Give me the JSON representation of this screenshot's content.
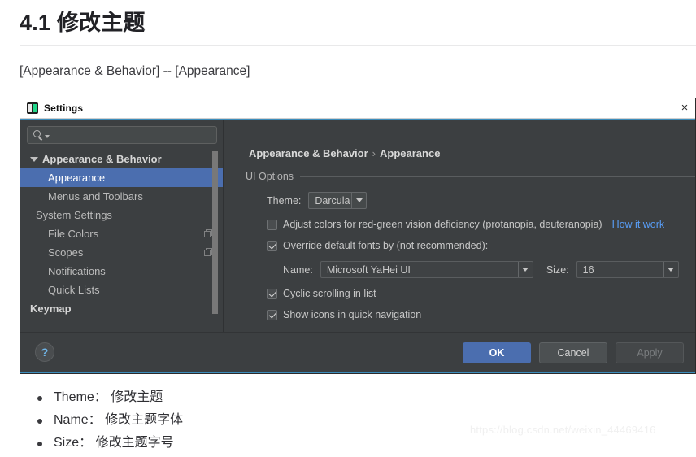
{
  "article": {
    "title": "4.1 修改主题",
    "subtitle": "[Appearance & Behavior] -- [Appearance]",
    "bullets": [
      "Theme： 修改主题",
      "Name： 修改主题字体",
      "Size： 修改主题字号"
    ],
    "watermark": "https://blog.csdn.net/weixin_44469416"
  },
  "window": {
    "title": "Settings",
    "app_icon": "pycharm-icon",
    "close_icon": "×",
    "accent_color": "#3c8dbc"
  },
  "sidebar": {
    "search": {
      "value": "",
      "placeholder": "",
      "icon": "search-icon",
      "caret_icon": "chevron-down-icon"
    },
    "items": [
      {
        "label": "Appearance & Behavior",
        "twisty": "down",
        "indent": 0,
        "bold": true,
        "selected": false,
        "badge": false
      },
      {
        "label": "Appearance",
        "twisty": "none",
        "indent": 1,
        "bold": false,
        "selected": true,
        "badge": false
      },
      {
        "label": "Menus and Toolbars",
        "twisty": "none",
        "indent": 1,
        "bold": false,
        "selected": false,
        "badge": false
      },
      {
        "label": "System Settings",
        "twisty": "right",
        "indent": 1,
        "bold": false,
        "selected": false,
        "badge": false
      },
      {
        "label": "File Colors",
        "twisty": "none",
        "indent": 1,
        "bold": false,
        "selected": false,
        "badge": true
      },
      {
        "label": "Scopes",
        "twisty": "none",
        "indent": 1,
        "bold": false,
        "selected": false,
        "badge": true
      },
      {
        "label": "Notifications",
        "twisty": "none",
        "indent": 1,
        "bold": false,
        "selected": false,
        "badge": false
      },
      {
        "label": "Quick Lists",
        "twisty": "none",
        "indent": 1,
        "bold": false,
        "selected": false,
        "badge": false
      },
      {
        "label": "Keymap",
        "twisty": "none",
        "indent": 0,
        "bold": true,
        "selected": false,
        "badge": false
      }
    ]
  },
  "main": {
    "breadcrumb": {
      "root": "Appearance & Behavior",
      "separator": "›",
      "leaf": "Appearance"
    },
    "group_title": "UI Options",
    "theme": {
      "label": "Theme:",
      "value": "Darcula"
    },
    "colorblind": {
      "label": "Adjust colors for red-green vision deficiency (protanopia, deuteranopia)",
      "checked": false,
      "link": "How it work"
    },
    "override_fonts": {
      "label": "Override default fonts by (not recommended):",
      "checked": true
    },
    "font_name": {
      "label": "Name:",
      "value": "Microsoft YaHei UI"
    },
    "font_size": {
      "label": "Size:",
      "value": "16"
    },
    "cyclic_scrolling": {
      "label": "Cyclic scrolling in list",
      "checked": true
    },
    "show_icons": {
      "label": "Show icons in quick navigation",
      "checked": true
    }
  },
  "footer": {
    "help_label": "?",
    "ok": "OK",
    "cancel": "Cancel",
    "apply": "Apply"
  }
}
